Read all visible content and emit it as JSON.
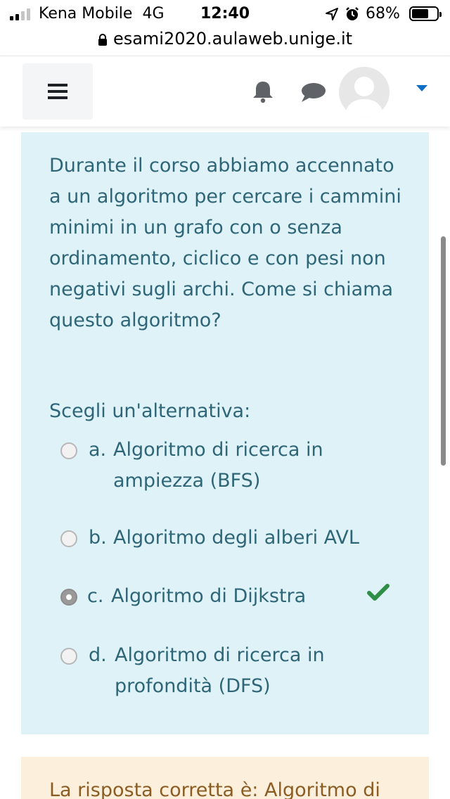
{
  "status_bar": {
    "carrier": "Kena Mobile",
    "network": "4G",
    "time": "12:40",
    "battery_percent": "68%",
    "battery_level": 0.68,
    "signal_bars": 2,
    "icons": [
      "signal-icon",
      "location-icon",
      "alarm-icon",
      "battery-icon"
    ]
  },
  "browser": {
    "url": "esami2020.aulaweb.unige.it"
  },
  "navbar": {
    "icons": [
      "menu-icon",
      "bell-icon",
      "chat-icon",
      "avatar",
      "caret-down-icon"
    ],
    "accent": "#0f6fc5"
  },
  "question": {
    "text": "Durante il corso abbiamo accennato a un algoritmo per cercare i cammini minimi in un grafo con o senza ordinamento, ciclico e con pesi non negativi sugli archi. Come si chiama questo algoritmo?",
    "prompt": "Scegli un'alternativa:",
    "options": [
      {
        "letter": "a.",
        "text": "Algoritmo di ricerca in ampiezza (BFS)",
        "selected": false,
        "correct": false
      },
      {
        "letter": "b.",
        "text": "Algoritmo degli alberi AVL",
        "selected": false,
        "correct": false
      },
      {
        "letter": "c.",
        "text": "Algoritmo di Dijkstra",
        "selected": true,
        "correct": true
      },
      {
        "letter": "d.",
        "text": "Algoritmo di ricerca in profondità (DFS)",
        "selected": false,
        "correct": false
      }
    ],
    "colors": {
      "background": "#def2f8",
      "text": "#2e6677",
      "correct": "#2f8f46"
    }
  },
  "feedback": {
    "text": "La risposta corretta è: Algoritmo di",
    "colors": {
      "background": "#fcefdc",
      "text": "#8b5d22"
    }
  }
}
